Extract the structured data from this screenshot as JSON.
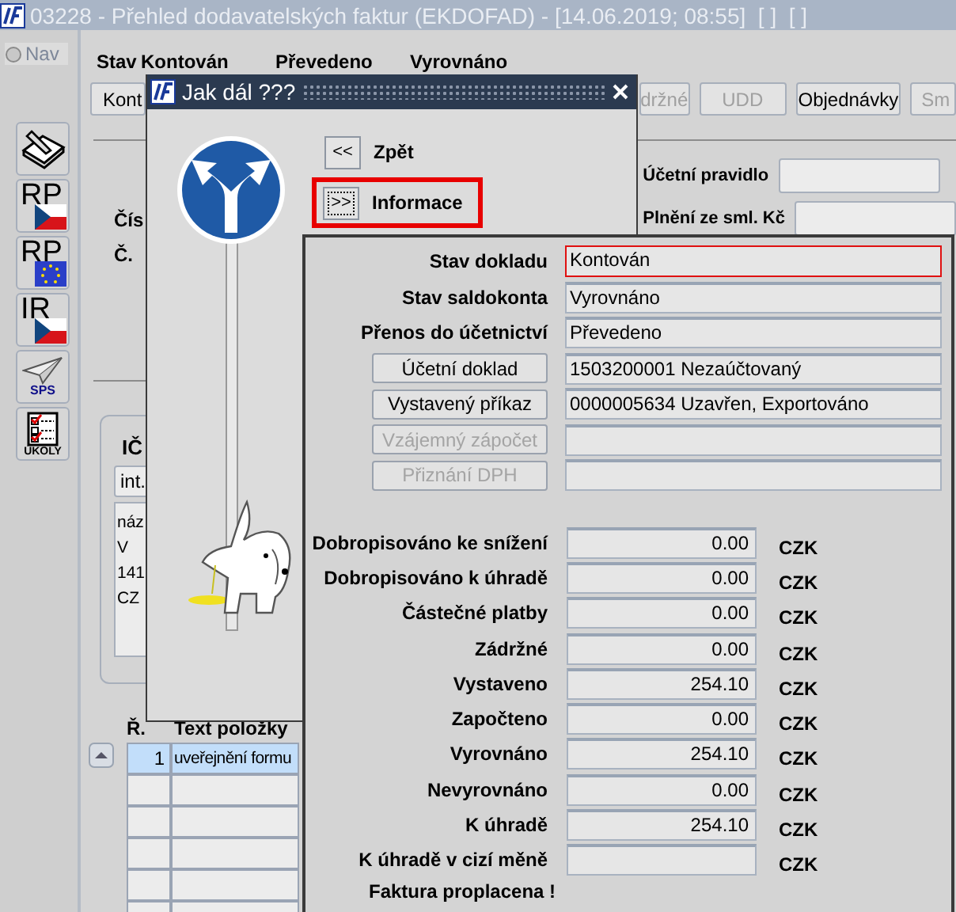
{
  "window": {
    "title": "03228 - Přehled dodavatelských faktur (EKDOFAD) - [14.06.2019; 08:55]  [ ]  [ ]"
  },
  "nav": {
    "label": "Nav"
  },
  "side_toolbar": [
    {
      "kind": "pen"
    },
    {
      "kind": "cz_badge",
      "label": "RP"
    },
    {
      "kind": "eu_badge",
      "label": "RP"
    },
    {
      "kind": "cz_badge",
      "label": "IR"
    },
    {
      "kind": "plane",
      "label": "SPS"
    },
    {
      "kind": "checklist",
      "label": "ÚKOLY"
    }
  ],
  "status_row": {
    "label": "Stav",
    "values": [
      "Kontován",
      "Převedeno",
      "Vyrovnáno"
    ]
  },
  "toolbar": [
    {
      "label": "Kont",
      "disabled": false
    },
    {
      "label": "držné",
      "disabled": true
    },
    {
      "label": "UDD",
      "disabled": true
    },
    {
      "label": "Objednávky",
      "disabled": false
    },
    {
      "label": "Sm",
      "disabled": true
    }
  ],
  "form": {
    "left_labels": [
      "Čís",
      "Č."
    ],
    "right_fields": [
      {
        "label": "Účetní pravidlo"
      },
      {
        "label": "Plnění ze sml. Kč"
      }
    ]
  },
  "partner": {
    "label": "IČ",
    "field": "int.",
    "address": [
      "náz",
      "V",
      "141",
      "CZ"
    ]
  },
  "items_table": {
    "columns": [
      "Ř.",
      "Text položky"
    ],
    "rows": [
      {
        "cells": [
          "1",
          "uveřejnění formu"
        ],
        "selected": true
      }
    ]
  },
  "dialog": {
    "title": "Jak dál ???",
    "buttons": [
      {
        "label": "<<",
        "caption": "Zpět",
        "highlighted": false
      },
      {
        "label": ">>",
        "caption": "Informace",
        "highlighted": true
      }
    ]
  },
  "info": {
    "status_fields": [
      {
        "kind": "label",
        "label": "Stav dokladu",
        "value": "Kontován",
        "highlighted": true
      },
      {
        "kind": "label",
        "label": "Stav saldokonta",
        "value": "Vyrovnáno",
        "highlighted": false
      },
      {
        "kind": "label",
        "label": "Přenos do účetnictví",
        "value": "Převedeno",
        "highlighted": false
      },
      {
        "kind": "button",
        "label": "Účetní doklad",
        "value": "1503200001 Nezaúčtovaný",
        "disabled": false
      },
      {
        "kind": "button",
        "label": "Vystavený příkaz",
        "value": "0000005634 Uzavřen, Exportováno",
        "disabled": false
      },
      {
        "kind": "button",
        "label": "Vzájemný zápočet",
        "disabled": true
      },
      {
        "kind": "button",
        "label": "Přiznání DPH",
        "disabled": true
      }
    ],
    "amounts": [
      {
        "label": "Dobropisováno ke snížení",
        "value": "0.00",
        "currency": "CZK"
      },
      {
        "label": "Dobropisováno k úhradě",
        "value": "0.00",
        "currency": "CZK"
      },
      {
        "label": "Částečné platby",
        "value": "0.00",
        "currency": "CZK"
      },
      {
        "label": "Zádržné",
        "value": "0.00",
        "currency": "CZK"
      },
      {
        "label": "Vystaveno",
        "value": "254.10",
        "currency": "CZK"
      },
      {
        "label": "Započteno",
        "value": "0.00",
        "currency": "CZK"
      },
      {
        "label": "Vyrovnáno",
        "value": "254.10",
        "currency": "CZK"
      },
      {
        "label": "Nevyrovnáno",
        "value": "0.00",
        "currency": "CZK"
      },
      {
        "label": "K úhradě",
        "value": "254.10",
        "currency": "CZK"
      },
      {
        "label": "K úhradě v cizí měně",
        "currency": "CZK"
      }
    ],
    "note": "Faktura proplacena !"
  }
}
